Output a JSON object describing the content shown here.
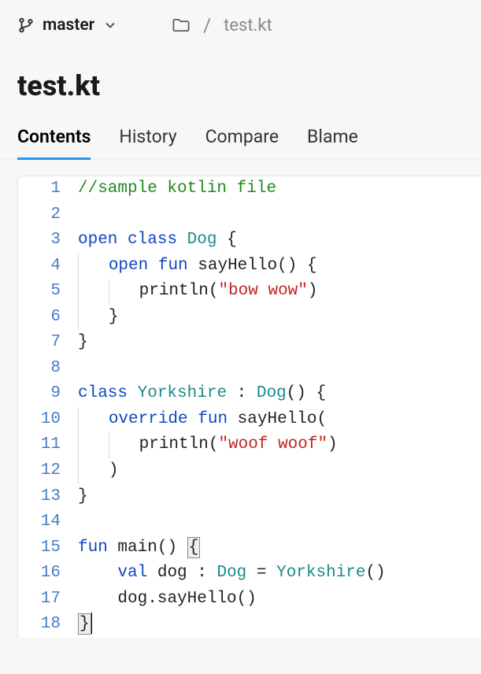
{
  "branch": "master",
  "breadcrumb_file": "test.kt",
  "page_title": "test.kt",
  "tabs": {
    "contents": "Contents",
    "history": "History",
    "compare": "Compare",
    "blame": "Blame"
  },
  "code": {
    "lines": [
      {
        "num": "1",
        "tokens": [
          [
            "comment",
            "//sample kotlin file"
          ]
        ],
        "indent": 0
      },
      {
        "num": "2",
        "tokens": [],
        "indent": 0
      },
      {
        "num": "3",
        "tokens": [
          [
            "keyword",
            "open"
          ],
          [
            "plain",
            " "
          ],
          [
            "keyword",
            "class"
          ],
          [
            "plain",
            " "
          ],
          [
            "type",
            "Dog"
          ],
          [
            "plain",
            " {"
          ]
        ],
        "indent": 0
      },
      {
        "num": "4",
        "tokens": [
          [
            "keyword",
            "open"
          ],
          [
            "plain",
            " "
          ],
          [
            "keyword",
            "fun"
          ],
          [
            "plain",
            " "
          ],
          [
            "func",
            "sayHello"
          ],
          [
            "plain",
            "() {"
          ]
        ],
        "indent": 1,
        "guide": true
      },
      {
        "num": "5",
        "tokens": [
          [
            "func",
            "println"
          ],
          [
            "plain",
            "("
          ],
          [
            "string",
            "\"bow wow\""
          ],
          [
            "plain",
            ")"
          ]
        ],
        "indent": 2,
        "guide2": true
      },
      {
        "num": "6",
        "tokens": [
          [
            "plain",
            "}"
          ]
        ],
        "indent": 1,
        "guide": true
      },
      {
        "num": "7",
        "tokens": [
          [
            "plain",
            "}"
          ]
        ],
        "indent": 0
      },
      {
        "num": "8",
        "tokens": [],
        "indent": 0
      },
      {
        "num": "9",
        "tokens": [
          [
            "keyword",
            "class"
          ],
          [
            "plain",
            " "
          ],
          [
            "type",
            "Yorkshire"
          ],
          [
            "plain",
            " : "
          ],
          [
            "type",
            "Dog"
          ],
          [
            "plain",
            "() {"
          ]
        ],
        "indent": 0
      },
      {
        "num": "10",
        "tokens": [
          [
            "keyword",
            "override"
          ],
          [
            "plain",
            " "
          ],
          [
            "keyword",
            "fun"
          ],
          [
            "plain",
            " "
          ],
          [
            "func",
            "sayHello"
          ],
          [
            "plain",
            "("
          ]
        ],
        "indent": 1,
        "guide": true
      },
      {
        "num": "11",
        "tokens": [
          [
            "func",
            "println"
          ],
          [
            "plain",
            "("
          ],
          [
            "string",
            "\"woof woof\""
          ],
          [
            "plain",
            ")"
          ]
        ],
        "indent": 2,
        "guide2": true
      },
      {
        "num": "12",
        "tokens": [
          [
            "plain",
            ")"
          ]
        ],
        "indent": 1,
        "guide": true
      },
      {
        "num": "13",
        "tokens": [
          [
            "plain",
            "}"
          ]
        ],
        "indent": 0
      },
      {
        "num": "14",
        "tokens": [],
        "indent": 0
      },
      {
        "num": "15",
        "tokens": [
          [
            "keyword",
            "fun"
          ],
          [
            "plain",
            " "
          ],
          [
            "func",
            "main"
          ],
          [
            "plain",
            "() "
          ],
          [
            "cursor-open",
            "{"
          ]
        ],
        "indent": 0
      },
      {
        "num": "16",
        "tokens": [
          [
            "keyword",
            "val"
          ],
          [
            "plain",
            " "
          ],
          [
            "ident",
            "dog"
          ],
          [
            "plain",
            " : "
          ],
          [
            "type",
            "Dog"
          ],
          [
            "plain",
            " = "
          ],
          [
            "type",
            "Yorkshire"
          ],
          [
            "plain",
            "()"
          ]
        ],
        "indent": 1
      },
      {
        "num": "17",
        "tokens": [
          [
            "ident",
            "dog"
          ],
          [
            "plain",
            "."
          ],
          [
            "func",
            "sayHello"
          ],
          [
            "plain",
            "()"
          ]
        ],
        "indent": 1
      },
      {
        "num": "18",
        "tokens": [
          [
            "cursor-close",
            "}"
          ]
        ],
        "indent": 0,
        "caret": true
      }
    ]
  }
}
